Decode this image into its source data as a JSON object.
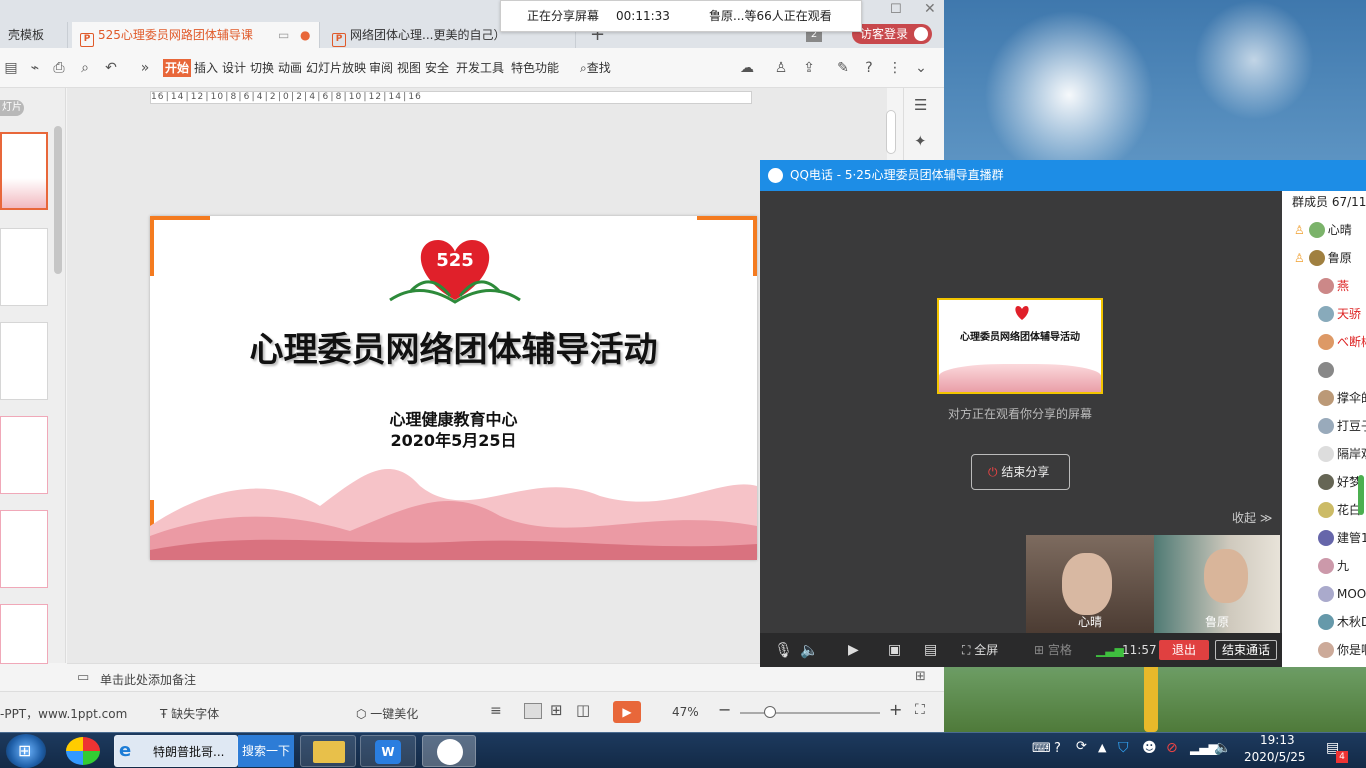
{
  "share_banner": {
    "status": "正在分享屏幕",
    "timer": "00:11:33",
    "viewers": "鲁原...等66人正在观看"
  },
  "wps": {
    "tabs": [
      {
        "label": "壳模板"
      },
      {
        "label": "525心理委员网路团体辅导课",
        "active": true
      },
      {
        "label": "网络团体心理...更美的自己）"
      }
    ],
    "tab_count": "2",
    "login_button": "访客登录",
    "menus": [
      "开始",
      "插入",
      "设计",
      "切换",
      "动画",
      "幻灯片放映",
      "审阅",
      "视图",
      "安全",
      "开发工具",
      "特色功能"
    ],
    "search_label": "查找",
    "thumbs_label": "灯片",
    "ruler_text": "16│14│12│10│8│6│4│2│0│2│4│6│8│10│12│14│16",
    "notes_placeholder": "单击此处添加备注",
    "status": {
      "source": "-PPT，www.1ppt.com",
      "missing_fonts": "缺失字体",
      "beautify": "一键美化",
      "zoom": "47%"
    }
  },
  "slide": {
    "logo_number": "525",
    "title": "心理委员网络团体辅导活动",
    "org": "心理健康教育中心",
    "date": "2020年5月25日"
  },
  "qq": {
    "title": "QQ电话 - 5·25心理委员团体辅导直播群",
    "preview_caption": "对方正在观看你分享的屏幕",
    "preview_title": "心理委员网络团体辅导活动",
    "stop_share": "结束分享",
    "collapse": "收起",
    "videos": [
      {
        "name": "心晴"
      },
      {
        "name": "鲁原"
      }
    ],
    "toolbar": {
      "fullscreen": "全屏",
      "grid": "宫格",
      "time": "11:57",
      "exit": "退出",
      "end_call": "结束通话"
    },
    "members_header": "群成员 67/11",
    "members": [
      {
        "name": "心晴",
        "color": "#222"
      },
      {
        "name": "鲁原",
        "color": "#222"
      },
      {
        "name": "燕",
        "color": "#d22"
      },
      {
        "name": "天骄",
        "color": "#d22"
      },
      {
        "name": "べ断彬",
        "color": "#d22"
      },
      {
        "name": "",
        "color": "#222"
      },
      {
        "name": "撑伞的",
        "color": "#222"
      },
      {
        "name": "打豆子",
        "color": "#222"
      },
      {
        "name": "隔岸观",
        "color": "#222"
      },
      {
        "name": "好梦",
        "color": "#222"
      },
      {
        "name": "花白",
        "color": "#222"
      },
      {
        "name": "建管1",
        "color": "#222"
      },
      {
        "name": "九",
        "color": "#222"
      },
      {
        "name": "MOO",
        "color": "#222"
      },
      {
        "name": "木秋D",
        "color": "#222"
      },
      {
        "name": "你是啊",
        "color": "#222"
      }
    ]
  },
  "taskbar": {
    "ie_label": "特朗普批哥...",
    "search_button": "搜索一下",
    "clock_time": "19:13",
    "clock_date": "2020/5/25",
    "notify_count": "4"
  }
}
